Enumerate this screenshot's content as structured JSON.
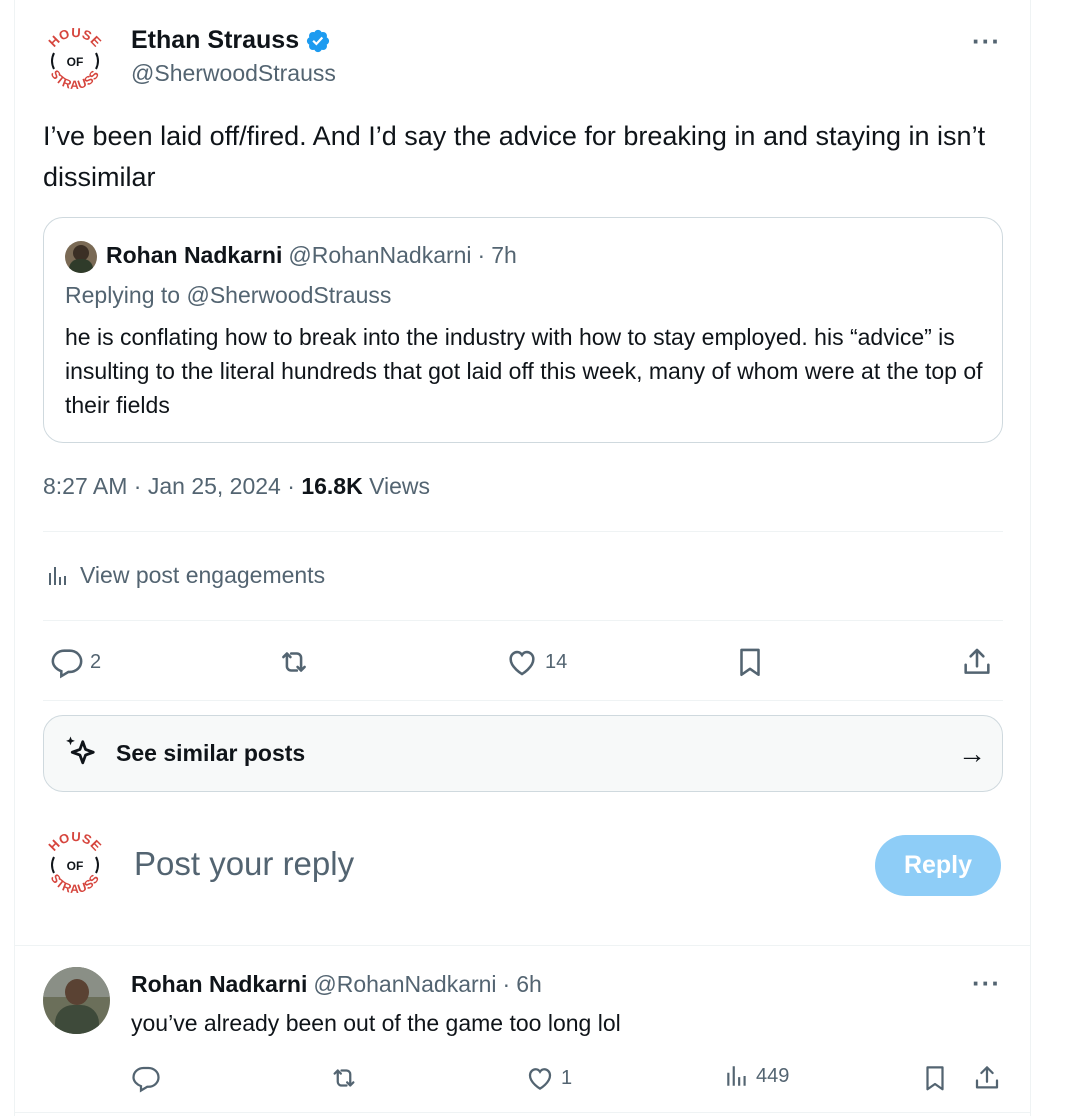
{
  "post": {
    "author": {
      "name": "Ethan Strauss",
      "handle": "@SherwoodStrauss",
      "verified": true,
      "avatar_logo_text": [
        "HOUSE",
        "OF",
        "STRAUSS"
      ]
    },
    "more_label": "···",
    "text": "I’ve been laid off/fired. And I’d say the advice for breaking in and staying in isn’t dissimilar",
    "quote": {
      "name": "Rohan Nadkarni",
      "handle": "@RohanNadkarni",
      "sep": "·",
      "time": "7h",
      "replying_to_prefix": "Replying to ",
      "replying_to_handle": "@SherwoodStrauss",
      "text": "he is conflating how to break into the industry with how to stay employed. his “advice” is insulting to the literal hundreds that got laid off this week, many of whom were at the top of their fields"
    },
    "time": "8:27 AM",
    "date": "Jan 25, 2024",
    "sep": "·",
    "views_count": "16.8K",
    "views_label": "Views",
    "engagements_label": "View post engagements",
    "actions": {
      "replies": "2",
      "reposts": "",
      "likes": "14"
    }
  },
  "similar": {
    "label": "See similar posts",
    "arrow": "→"
  },
  "composer": {
    "placeholder": "Post your reply",
    "button": "Reply"
  },
  "reply": {
    "name": "Rohan Nadkarni",
    "handle": "@RohanNadkarni",
    "sep": "·",
    "time": "6h",
    "more_label": "···",
    "text": "you’ve already been out of the game too long lol",
    "actions": {
      "replies": "",
      "reposts": "",
      "likes": "1",
      "views": "449"
    }
  },
  "colors": {
    "accent": "#1d9bf0",
    "reply_button": "#8ecdf7",
    "logo_red": "#d6453d",
    "muted": "#536471"
  }
}
